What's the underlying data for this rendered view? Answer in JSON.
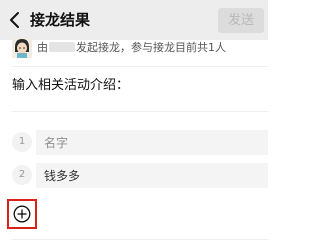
{
  "header": {
    "title": "接龙结果",
    "send_label": "发送",
    "back_icon": "chevron-left-icon"
  },
  "info_line": {
    "prefix": "由",
    "middle": "发起接龙，参与接龙目前共1人"
  },
  "activity_heading": "输入相关活动介绍：",
  "entries": [
    {
      "number": "1",
      "placeholder": "名字"
    },
    {
      "number": "2",
      "value": "钱多多"
    }
  ],
  "add_icon": "plus-circle-icon",
  "colors": {
    "topbar_bg": "#ededed",
    "send_disabled_bg": "#dcdcdc",
    "highlight_border": "#d9221a"
  }
}
